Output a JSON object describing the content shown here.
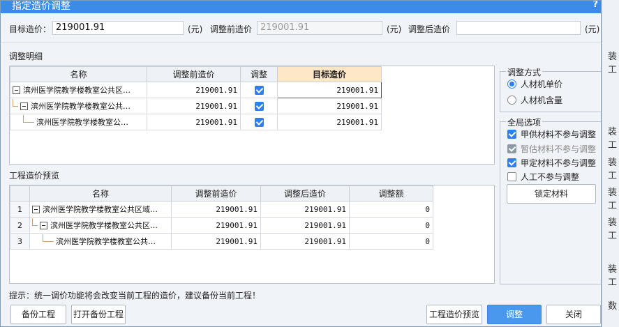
{
  "title": "指定造价调整",
  "help_glyph": "?",
  "fields": {
    "target_label": "目标造价：",
    "target_value": "219001.91",
    "target_unit": "(元)",
    "before_label": "调整前造价",
    "before_value": "219001.91",
    "before_unit": "(元)",
    "after_label": "调整后造价",
    "after_value": "",
    "after_unit": "(元)"
  },
  "detail": {
    "title": "调整明细",
    "columns": [
      "名称",
      "调整前造价",
      "调整",
      "目标造价"
    ],
    "rows": [
      {
        "name": "滨州医学院教学楼教室公共区…",
        "before": "219001.91",
        "adjust": true,
        "target": "219001.91"
      },
      {
        "name": "滨州医学院教学楼教室公共…",
        "before": "219001.91",
        "adjust": true,
        "target": "219001.91"
      },
      {
        "name": "滨州医学院教学楼教室公…",
        "before": "219001.91",
        "adjust": true,
        "target": "219001.91"
      }
    ]
  },
  "preview": {
    "title": "工程造价预览",
    "columns": [
      "名称",
      "调整前造价",
      "调整后造价",
      "调整额"
    ],
    "rows": [
      {
        "idx": "1",
        "name": "滨州医学院教学楼教室公共区域…",
        "before": "219001.91",
        "after": "219001.91",
        "delta": "0"
      },
      {
        "idx": "2",
        "name": "滨州医学院教学楼教室公共区…",
        "before": "219001.91",
        "after": "219001.91",
        "delta": "0"
      },
      {
        "idx": "3",
        "name": "滨州医学院教学楼教室公共…",
        "before": "219001.91",
        "after": "219001.91",
        "delta": "0"
      }
    ]
  },
  "mode": {
    "title": "调整方式",
    "options": [
      "人材机单价",
      "人材机含量"
    ],
    "selected": "人材机单价"
  },
  "global": {
    "title": "全局选项",
    "options": [
      {
        "label": "甲供材料不参与调整",
        "checked": true,
        "disabled": false
      },
      {
        "label": "暂估材料不参与调整",
        "checked": true,
        "disabled": true
      },
      {
        "label": "甲定材料不参与调整",
        "checked": true,
        "disabled": false
      },
      {
        "label": "人工不参与调整",
        "checked": false,
        "disabled": false
      }
    ],
    "lock_button": "锁定材料"
  },
  "tip": "提示：统一调价功能将会改变当前工程的造价，建议备份当前工程！",
  "buttons": {
    "backup": "备份工程",
    "open_backup": "打开备份工程",
    "preview": "工程造价预览",
    "adjust": "调整",
    "close": "关闭"
  },
  "background": {
    "snippets": [
      "装工",
      "装工",
      "装工",
      "装工",
      "装工",
      "装工",
      "数"
    ]
  },
  "colors": {
    "titlebar": "#3c8ce7",
    "accent": "#2f80ed",
    "target_header": "#fde7c7"
  }
}
